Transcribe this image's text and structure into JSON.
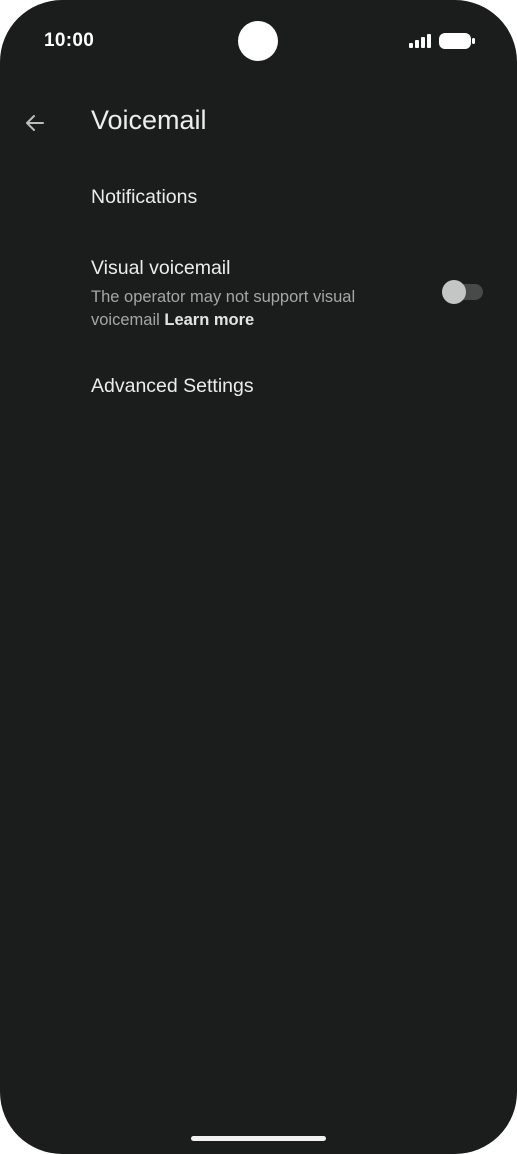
{
  "status_bar": {
    "time": "10:00",
    "signal_icon": "signal-bars-icon",
    "battery_icon": "battery-full-icon"
  },
  "app_bar": {
    "back_icon": "arrow-back-icon",
    "title": "Voicemail"
  },
  "settings": {
    "notifications": {
      "title": "Notifications"
    },
    "visual_voicemail": {
      "title": "Visual voicemail",
      "summary": "The operator may not support visual voicemail",
      "link": "Learn more",
      "enabled": false
    },
    "advanced": {
      "title": "Advanced Settings"
    }
  },
  "colors": {
    "background": "#1b1c1c",
    "primary_text": "#ececec",
    "secondary_text": "#a6a6a6",
    "toggle_track_off": "#484a4a",
    "toggle_thumb_off": "#c4c6c6"
  }
}
